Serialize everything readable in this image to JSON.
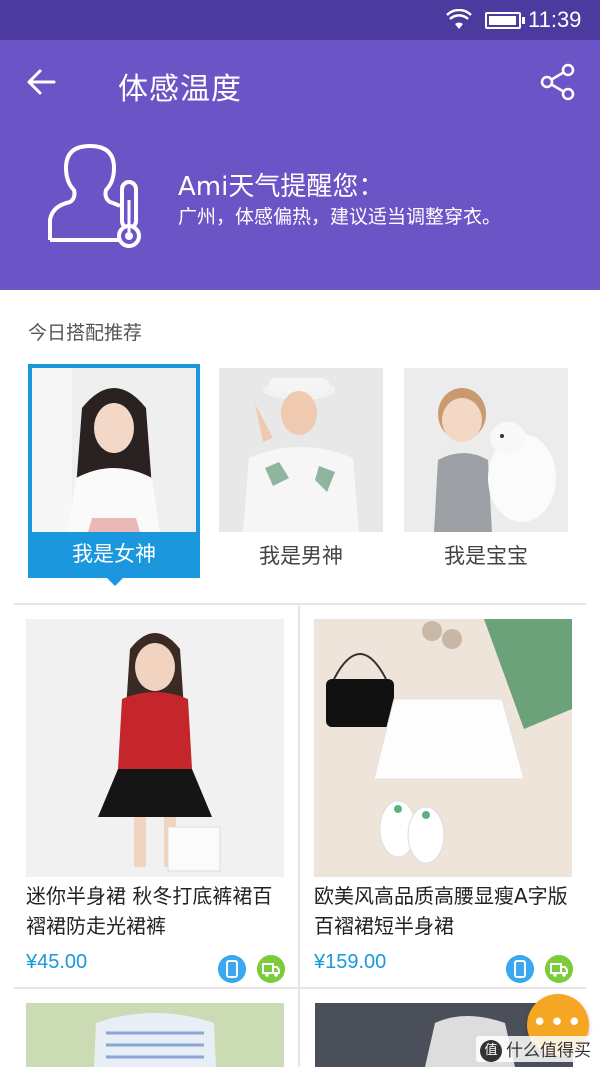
{
  "status_bar": {
    "time": "11:39"
  },
  "header": {
    "title": "体感温度",
    "reminder_title": "Ami天气提醒您：",
    "reminder_text": "广州，体感偏热，建议适当调整穿衣。",
    "background_color": "#6b55c6"
  },
  "section": {
    "label": "今日搭配推荐"
  },
  "categories": [
    {
      "label": "我是女神",
      "active": true
    },
    {
      "label": "我是男神",
      "active": false
    },
    {
      "label": "我是宝宝",
      "active": false
    }
  ],
  "products": [
    {
      "name": "迷你半身裙 秋冬打底裤裙百褶裙防走光裙裤",
      "price": "¥45.00",
      "badges": [
        "mobile-icon",
        "truck-icon"
      ]
    },
    {
      "name": "欧美风高品质高腰显瘦A字版百褶裙短半身裙",
      "price": "¥159.00",
      "badges": [
        "mobile-icon",
        "truck-icon"
      ]
    }
  ],
  "accent_color": "#1a97dd",
  "fab": {
    "label": "•••"
  },
  "watermark": {
    "text": "什么值得买",
    "logo_char": "值"
  }
}
